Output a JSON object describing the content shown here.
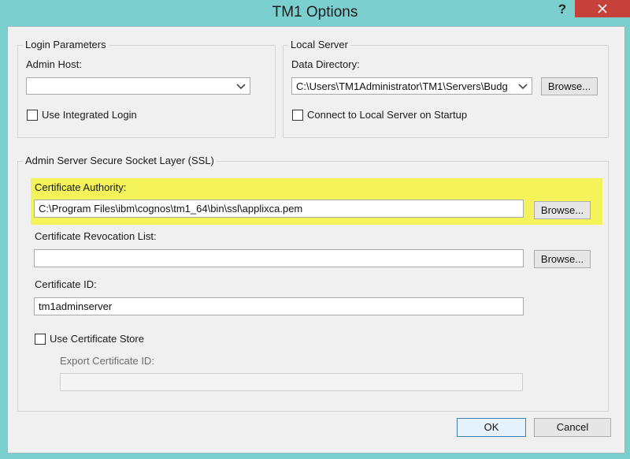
{
  "window": {
    "title": "TM1 Options",
    "help_glyph": "?"
  },
  "login": {
    "legend": "Login Parameters",
    "admin_host_label": "Admin Host:",
    "admin_host_value": "",
    "integrated_login_label": "Use Integrated Login",
    "integrated_login_checked": false
  },
  "local_server": {
    "legend": "Local Server",
    "data_dir_label": "Data Directory:",
    "data_dir_value": "C:\\Users\\TM1Administrator\\TM1\\Servers\\Budg",
    "browse_label": "Browse...",
    "connect_label": "Connect to Local Server on Startup",
    "connect_checked": false
  },
  "ssl": {
    "legend": "Admin Server Secure Socket Layer (SSL)",
    "cert_authority_label": "Certificate Authority:",
    "cert_authority_value": "C:\\Program Files\\ibm\\cognos\\tm1_64\\bin\\ssl\\applixca.pem",
    "cert_authority_browse": "Browse...",
    "revocation_label": "Certificate Revocation List:",
    "revocation_value": "",
    "revocation_browse": "Browse...",
    "cert_id_label": "Certificate ID:",
    "cert_id_value": "tm1adminserver",
    "use_store_label": "Use Certificate Store",
    "use_store_checked": false,
    "export_id_label": "Export Certificate ID:",
    "export_id_value": ""
  },
  "footer": {
    "ok_label": "OK",
    "cancel_label": "Cancel"
  },
  "colors": {
    "frame": "#7ccfcf",
    "close_button": "#c7413b",
    "highlight": "#f4f45a",
    "dialog_bg": "#f0f0f0"
  },
  "icons": {
    "dropdown": "chevron-down-icon",
    "close": "close-icon",
    "help": "help-icon"
  }
}
